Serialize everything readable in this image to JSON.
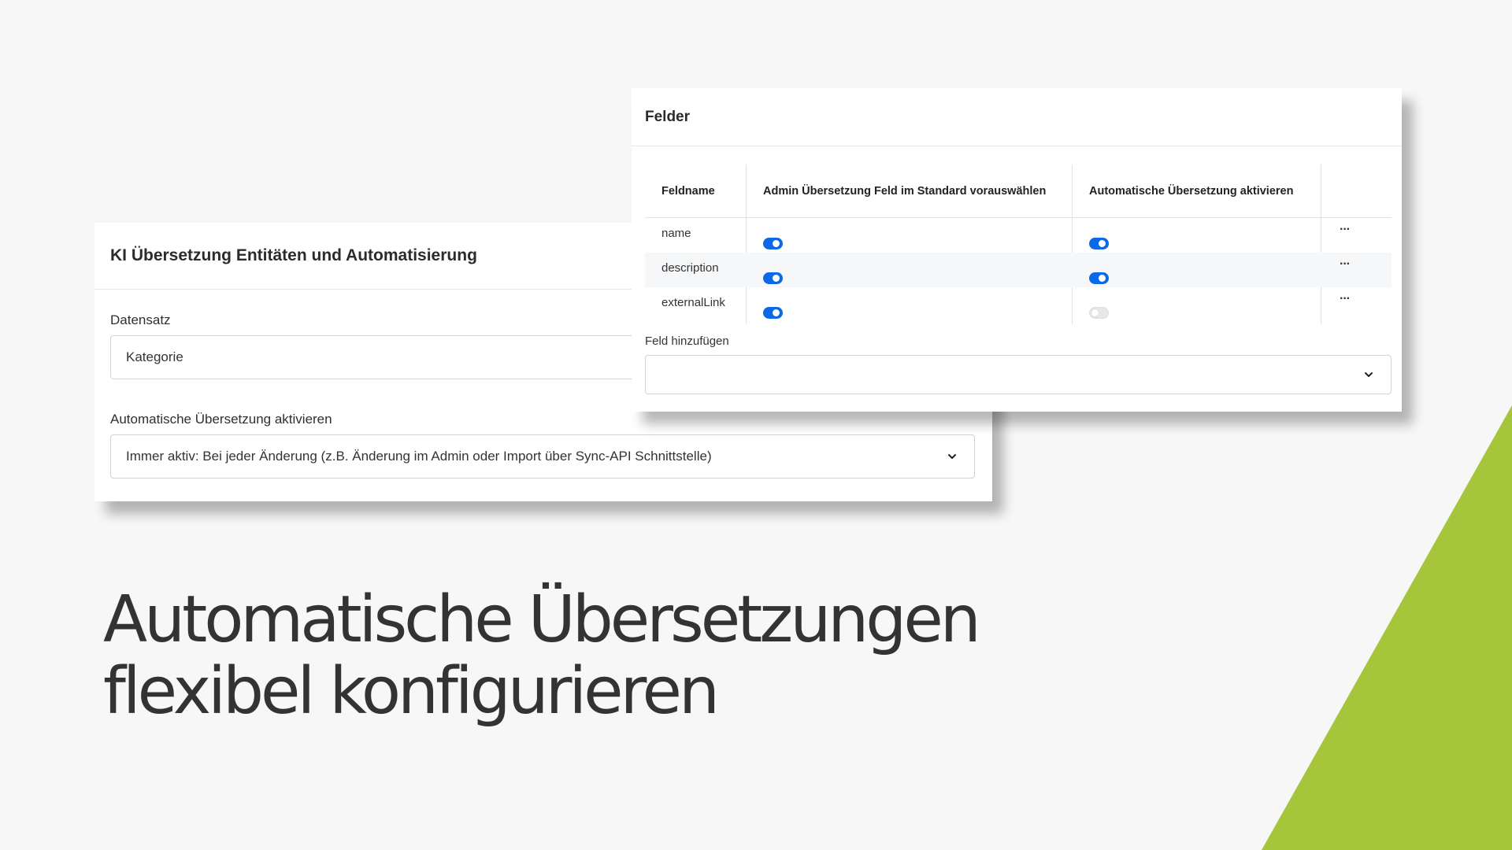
{
  "accent_colors": {
    "toggle_on": "#0b68e6",
    "toggle_off": "#e7e7e7",
    "green": "#a5c63a",
    "headline": "#333333"
  },
  "card_entity": {
    "title": "KI Übersetzung Entitäten und Automatisierung",
    "dataset_label": "Datensatz",
    "dataset_value": "Kategorie",
    "auto_label": "Automatische Übersetzung aktivieren",
    "auto_value": "Immer aktiv: Bei jeder Änderung (z.B. Änderung im Admin oder Import über Sync-API Schnittstelle)",
    "auto_icon": "chevron-down-icon"
  },
  "card_fields": {
    "title": "Felder",
    "columns": {
      "name": "Feldname",
      "admin": "Admin Übersetzung Feld im Standard vorauswählen",
      "auto": "Automatische Übersetzung aktivieren"
    },
    "rows": [
      {
        "name": "name",
        "admin": true,
        "auto": true,
        "more": "···"
      },
      {
        "name": "description",
        "admin": true,
        "auto": true,
        "more": "···"
      },
      {
        "name": "externalLink",
        "admin": true,
        "auto": false,
        "more": "···"
      }
    ],
    "add_label": "Feld hinzufügen",
    "add_value": "",
    "add_icon": "chevron-down-icon"
  },
  "headline": {
    "line1": "Automatische Übersetzungen",
    "line2": "flexibel konfigurieren"
  }
}
